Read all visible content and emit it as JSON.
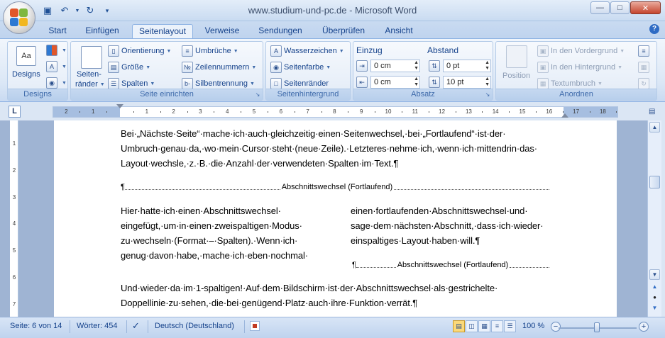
{
  "window": {
    "title": "www.studium-und-pc.de - Microsoft Word"
  },
  "tabs": [
    {
      "label": "Start",
      "active": false
    },
    {
      "label": "Einfügen",
      "active": false
    },
    {
      "label": "Seitenlayout",
      "active": true
    },
    {
      "label": "Verweise",
      "active": false
    },
    {
      "label": "Sendungen",
      "active": false
    },
    {
      "label": "Überprüfen",
      "active": false
    },
    {
      "label": "Ansicht",
      "active": false
    }
  ],
  "ribbon": {
    "designs": {
      "label": "Designs",
      "button": "Designs"
    },
    "seite_einrichten": {
      "label": "Seite einrichten",
      "seitenraender": "Seiten-",
      "seitenraender2": "ränder",
      "orientierung": "Orientierung",
      "groesse": "Größe",
      "spalten": "Spalten",
      "umbrueche": "Umbrüche",
      "zeilennummern": "Zeilennummern",
      "silbentrennung": "Silbentrennung"
    },
    "seitenhintergrund": {
      "label": "Seitenhintergrund",
      "wasserzeichen": "Wasserzeichen",
      "seitenfarbe": "Seitenfarbe",
      "seitenraender": "Seitenränder"
    },
    "absatz": {
      "label": "Absatz",
      "einzug": "Einzug",
      "abstand": "Abstand",
      "einzug_links": "0 cm",
      "einzug_rechts": "0 cm",
      "abstand_vor": "0 pt",
      "abstand_nach": "10 pt"
    },
    "anordnen": {
      "label": "Anordnen",
      "position": "Position",
      "vordergrund": "In den Vordergrund",
      "hintergrund": "In den Hintergrund",
      "textumbruch": "Textumbruch"
    }
  },
  "ruler": {
    "corner": "L",
    "ticks": [
      "2",
      "1",
      "1",
      "2",
      "3",
      "4",
      "5",
      "6",
      "7",
      "8",
      "9",
      "10",
      "11",
      "12",
      "13",
      "14",
      "15",
      "16",
      "17",
      "18"
    ],
    "vticks": [
      "1",
      "2",
      "3",
      "4",
      "5",
      "6",
      "7"
    ]
  },
  "document": {
    "para1": [
      "Bei·„Nächste·Seite“·mache·ich·auch·gleichzeitig·einen·Seitenwechsel,·bei·„Fortlaufend“·ist·der·",
      "Umbruch·genau·da,·wo·mein·Cursor·steht·(neue·Zeile).·Letzteres·nehme·ich,·wenn·ich·mittendrin·das·",
      "Layout·wechsle,·z.·B.·die·Anzahl·der·verwendeten·Spalten·im·Text.¶"
    ],
    "break1": {
      "mark": "¶",
      "label": "Abschnittswechsel (Fortlaufend)"
    },
    "col_left": [
      "Hier·hatte·ich·einen·Abschnittswechsel·",
      "eingefügt,·um·in·einen·zweispaltigen·Modus·",
      "zu·wechseln·(Format·–·Spalten).·Wenn·ich·",
      "genug·davon·habe,·mache·ich·eben·nochmal·"
    ],
    "col_right": [
      "einen·fortlaufenden·Abschnittswechsel·und·",
      "sage·dem·nächsten·Abschnitt,·dass·ich·wieder·",
      "einspaltiges·Layout·haben·will.¶"
    ],
    "break2": {
      "mark": "¶",
      "label": "Abschnittswechsel (Fortlaufend)"
    },
    "para2": [
      "Und·wieder·da·im·1-spaltigen!·Auf·dem·Bildschirm·ist·der·Abschnittswechsel·als·gestrichelte·",
      "Doppellinie·zu·sehen,·die·bei·genügend·Platz·auch·ihre·Funktion·verrät.¶"
    ]
  },
  "status": {
    "page": "Seite: 6 von 14",
    "words": "Wörter: 454",
    "language": "Deutsch (Deutschland)",
    "zoom": "100 %"
  }
}
